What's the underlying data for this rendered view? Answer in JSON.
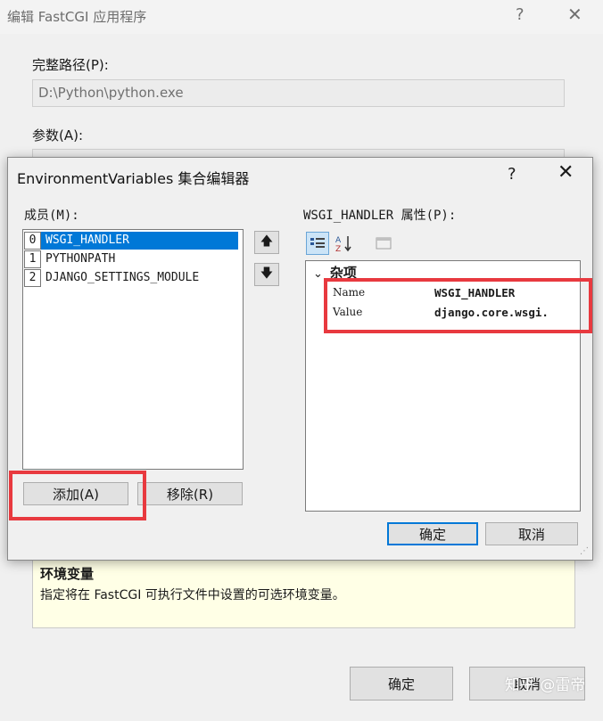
{
  "background_dialog": {
    "title": "编辑 FastCGI 应用程序",
    "help_glyph": "?",
    "close_glyph": "✕",
    "full_path_label": "完整路径(P):",
    "full_path_value": "D:\\Python\\python.exe",
    "arguments_label": "参数(A):",
    "description_title": "环境变量",
    "description_text": "指定将在 FastCGI 可执行文件中设置的可选环境变量。",
    "ok_label": "确定",
    "cancel_label": "取消"
  },
  "watermark": "知乎 @雷帝",
  "env_dialog": {
    "title": "EnvironmentVariables 集合编辑器",
    "help_glyph": "?",
    "close_glyph": "✕",
    "members_label": "成员(M):",
    "members": [
      {
        "index": "0",
        "name": "WSGI_HANDLER",
        "selected": true
      },
      {
        "index": "1",
        "name": "PYTHONPATH",
        "selected": false
      },
      {
        "index": "2",
        "name": "DJANGO_SETTINGS_MODULE",
        "selected": false
      }
    ],
    "move_up_glyph": "🡅",
    "move_down_glyph": "🡇",
    "add_label": "添加(A)",
    "remove_label": "移除(R)",
    "properties_label": "WSGI_HANDLER 属性(P):",
    "category": "杂项",
    "properties": [
      {
        "name": "Name",
        "value": "WSGI_HANDLER"
      },
      {
        "name": "Value",
        "value": "django.core.wsgi."
      }
    ],
    "ok_label": "确定",
    "cancel_label": "取消"
  },
  "icons": {
    "categorized": "categorized-view-icon",
    "alpha_sort": "alphabetical-sort-icon",
    "property_pages": "property-pages-icon"
  },
  "highlight_color": "#e8393f",
  "accent_color": "#0078d7"
}
